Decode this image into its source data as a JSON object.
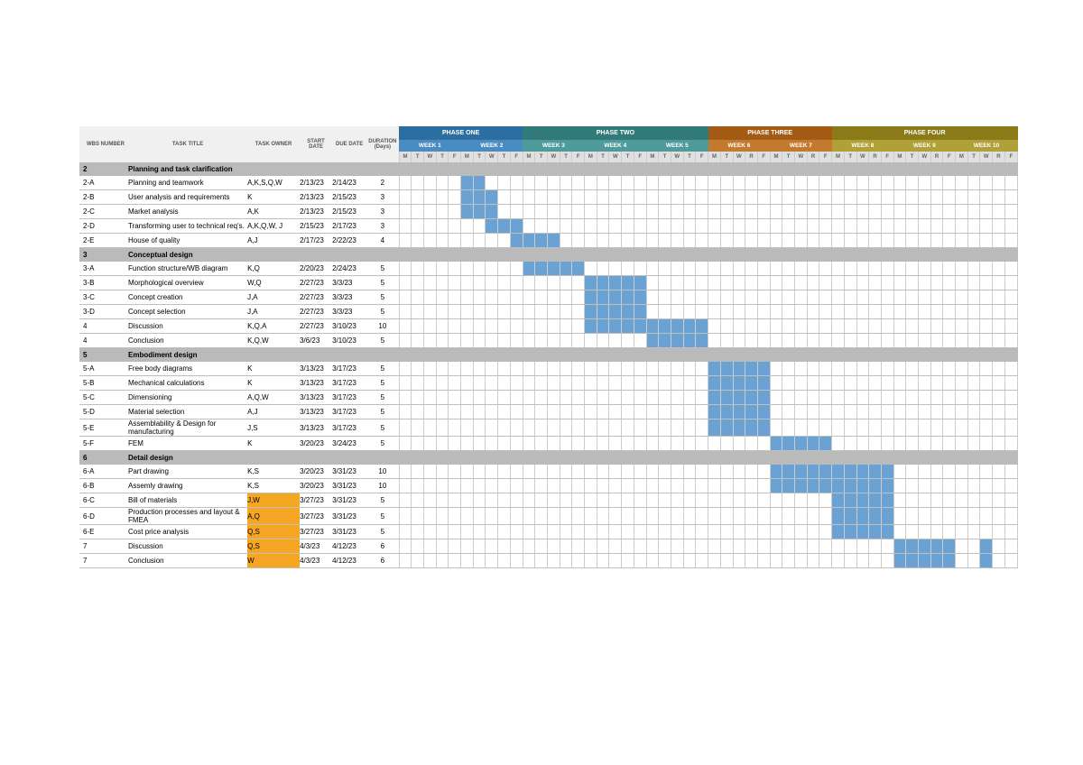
{
  "headers": {
    "wbs": "WBS NUMBER",
    "title": "TASK TITLE",
    "owner": "TASK OWNER",
    "start": "START DATE",
    "due": "DUE DATE",
    "dur_l1": "DURATION",
    "dur_l2": "(Days)"
  },
  "phases": [
    {
      "label": "PHASE ONE",
      "weeks": 2,
      "cls": "p1",
      "wcls": "w1",
      "days": [
        "M",
        "T",
        "W",
        "T",
        "F",
        "M",
        "T",
        "W",
        "T",
        "F"
      ],
      "wlabels": [
        "WEEK 1",
        "WEEK 2"
      ]
    },
    {
      "label": "PHASE TWO",
      "weeks": 3,
      "cls": "p2",
      "wcls": "w2",
      "days": [
        "M",
        "T",
        "W",
        "T",
        "F",
        "M",
        "T",
        "W",
        "T",
        "F",
        "M",
        "T",
        "W",
        "T",
        "F"
      ],
      "wlabels": [
        "WEEK 3",
        "WEEK 4",
        "WEEK 5"
      ]
    },
    {
      "label": "PHASE THREE",
      "weeks": 2,
      "cls": "p3",
      "wcls": "w3",
      "days": [
        "M",
        "T",
        "W",
        "R",
        "F",
        "M",
        "T",
        "W",
        "R",
        "F"
      ],
      "wlabels": [
        "WEEK 6",
        "WEEK 7"
      ]
    },
    {
      "label": "PHASE FOUR",
      "weeks": 3,
      "cls": "p4",
      "wcls": "w4",
      "days": [
        "M",
        "T",
        "W",
        "R",
        "F",
        "M",
        "T",
        "W",
        "R",
        "F",
        "M",
        "T",
        "W",
        "R",
        "F"
      ],
      "wlabels": [
        "WEEK 8",
        "WEEK 9",
        "WEEK 10"
      ]
    }
  ],
  "sections": [
    {
      "num": "2",
      "title": "Planning and task clarification",
      "rows": [
        {
          "wbs": "2-A",
          "t": "Planning and teamwork",
          "o": "A,K,S,Q,W",
          "s": "2/13/23",
          "d": "2/14/23",
          "dur": "2",
          "hl": false,
          "bar": [
            5,
            6
          ]
        },
        {
          "wbs": "2-B",
          "t": "User analysis and requirements",
          "o": "K",
          "s": "2/13/23",
          "d": "2/15/23",
          "dur": "3",
          "hl": false,
          "bar": [
            5,
            7
          ]
        },
        {
          "wbs": "2-C",
          "t": "Market analysis",
          "o": "A,K",
          "s": "2/13/23",
          "d": "2/15/23",
          "dur": "3",
          "hl": false,
          "bar": [
            5,
            7
          ]
        },
        {
          "wbs": "2-D",
          "t": "Transforming user to technical req's.",
          "o": "A,K,Q,W, J",
          "s": "2/15/23",
          "d": "2/17/23",
          "dur": "3",
          "hl": false,
          "bar": [
            7,
            9
          ]
        },
        {
          "wbs": "2-E",
          "t": "House of quality",
          "o": "A,J",
          "s": "2/17/23",
          "d": "2/22/23",
          "dur": "4",
          "hl": false,
          "bar": [
            9,
            12
          ]
        }
      ]
    },
    {
      "num": "3",
      "title": "Conceptual design",
      "rows": [
        {
          "wbs": "3-A",
          "t": "Function structure/WB diagram",
          "o": "K,Q",
          "s": "2/20/23",
          "d": "2/24/23",
          "dur": "5",
          "hl": false,
          "bar": [
            10,
            14
          ]
        },
        {
          "wbs": "3-B",
          "t": "Morphological overview",
          "o": "W,Q",
          "s": "2/27/23",
          "d": "3/3/23",
          "dur": "5",
          "hl": false,
          "bar": [
            15,
            19
          ]
        },
        {
          "wbs": "3-C",
          "t": "Concept creation",
          "o": "J,A",
          "s": "2/27/23",
          "d": "3/3/23",
          "dur": "5",
          "hl": false,
          "bar": [
            15,
            19
          ]
        },
        {
          "wbs": "3-D",
          "t": "Concept selection",
          "o": "J,A",
          "s": "2/27/23",
          "d": "3/3/23",
          "dur": "5",
          "hl": false,
          "bar": [
            15,
            19
          ]
        },
        {
          "wbs": "4",
          "t": "Discussion",
          "o": "K,Q,A",
          "s": "2/27/23",
          "d": "3/10/23",
          "dur": "10",
          "hl": false,
          "bar": [
            15,
            24
          ]
        },
        {
          "wbs": "4",
          "t": "Conclusion",
          "o": "K,Q,W",
          "s": "3/6/23",
          "d": "3/10/23",
          "dur": "5",
          "hl": false,
          "bar": [
            20,
            24
          ]
        }
      ]
    },
    {
      "num": "5",
      "title": "Embodiment design",
      "rows": [
        {
          "wbs": "5-A",
          "t": "Free body diagrams",
          "o": "K",
          "s": "3/13/23",
          "d": "3/17/23",
          "dur": "5",
          "hl": false,
          "bar": [
            25,
            29
          ]
        },
        {
          "wbs": "5-B",
          "t": "Mechanical calculations",
          "o": "K",
          "s": "3/13/23",
          "d": "3/17/23",
          "dur": "5",
          "hl": false,
          "bar": [
            25,
            29
          ]
        },
        {
          "wbs": "5-C",
          "t": "Dimensioning",
          "o": "A,Q,W",
          "s": "3/13/23",
          "d": "3/17/23",
          "dur": "5",
          "hl": false,
          "bar": [
            25,
            29
          ]
        },
        {
          "wbs": "5-D",
          "t": "Material selection",
          "o": "A,J",
          "s": "3/13/23",
          "d": "3/17/23",
          "dur": "5",
          "hl": false,
          "bar": [
            25,
            29
          ]
        },
        {
          "wbs": "5-E",
          "t": "Assemblability & Design for manufacturing",
          "o": "J,S",
          "s": "3/13/23",
          "d": "3/17/23",
          "dur": "5",
          "hl": false,
          "bar": [
            25,
            29
          ]
        },
        {
          "wbs": "5-F",
          "t": "FEM",
          "o": "K",
          "s": "3/20/23",
          "d": "3/24/23",
          "dur": "5",
          "hl": false,
          "bar": [
            30,
            34
          ]
        }
      ]
    },
    {
      "num": "6",
      "title": "Detail design",
      "rows": [
        {
          "wbs": "6-A",
          "t": "Part drawing",
          "o": "K,S",
          "s": "3/20/23",
          "d": "3/31/23",
          "dur": "10",
          "hl": false,
          "bar": [
            30,
            39
          ]
        },
        {
          "wbs": "6-B",
          "t": "Assemly drawing",
          "o": "K,S",
          "s": "3/20/23",
          "d": "3/31/23",
          "dur": "10",
          "hl": false,
          "bar": [
            30,
            39
          ]
        },
        {
          "wbs": "6-C",
          "t": "Bill of materials",
          "o": "J,W",
          "s": "3/27/23",
          "d": "3/31/23",
          "dur": "5",
          "hl": true,
          "bar": [
            35,
            39
          ]
        },
        {
          "wbs": "6-D",
          "t": "Production processes and layout & FMEA",
          "o": "A,Q",
          "s": "3/27/23",
          "d": "3/31/23",
          "dur": "5",
          "hl": true,
          "bar": [
            35,
            39
          ]
        },
        {
          "wbs": "6-E",
          "t": "Cost price analysis",
          "o": "Q,S",
          "s": "3/27/23",
          "d": "3/31/23",
          "dur": "5",
          "hl": true,
          "bar": [
            35,
            39
          ]
        },
        {
          "wbs": "7",
          "t": "Discussion",
          "o": "Q,S",
          "s": "4/3/23",
          "d": "4/12/23",
          "dur": "6",
          "hl": true,
          "bar": [
            40,
            44,
            47,
            47
          ]
        },
        {
          "wbs": "7",
          "t": "Conclusion",
          "o": "W",
          "s": "4/3/23",
          "d": "4/12/23",
          "dur": "6",
          "hl": true,
          "bar": [
            40,
            44,
            47,
            47
          ]
        }
      ]
    }
  ],
  "total_days": 50
}
